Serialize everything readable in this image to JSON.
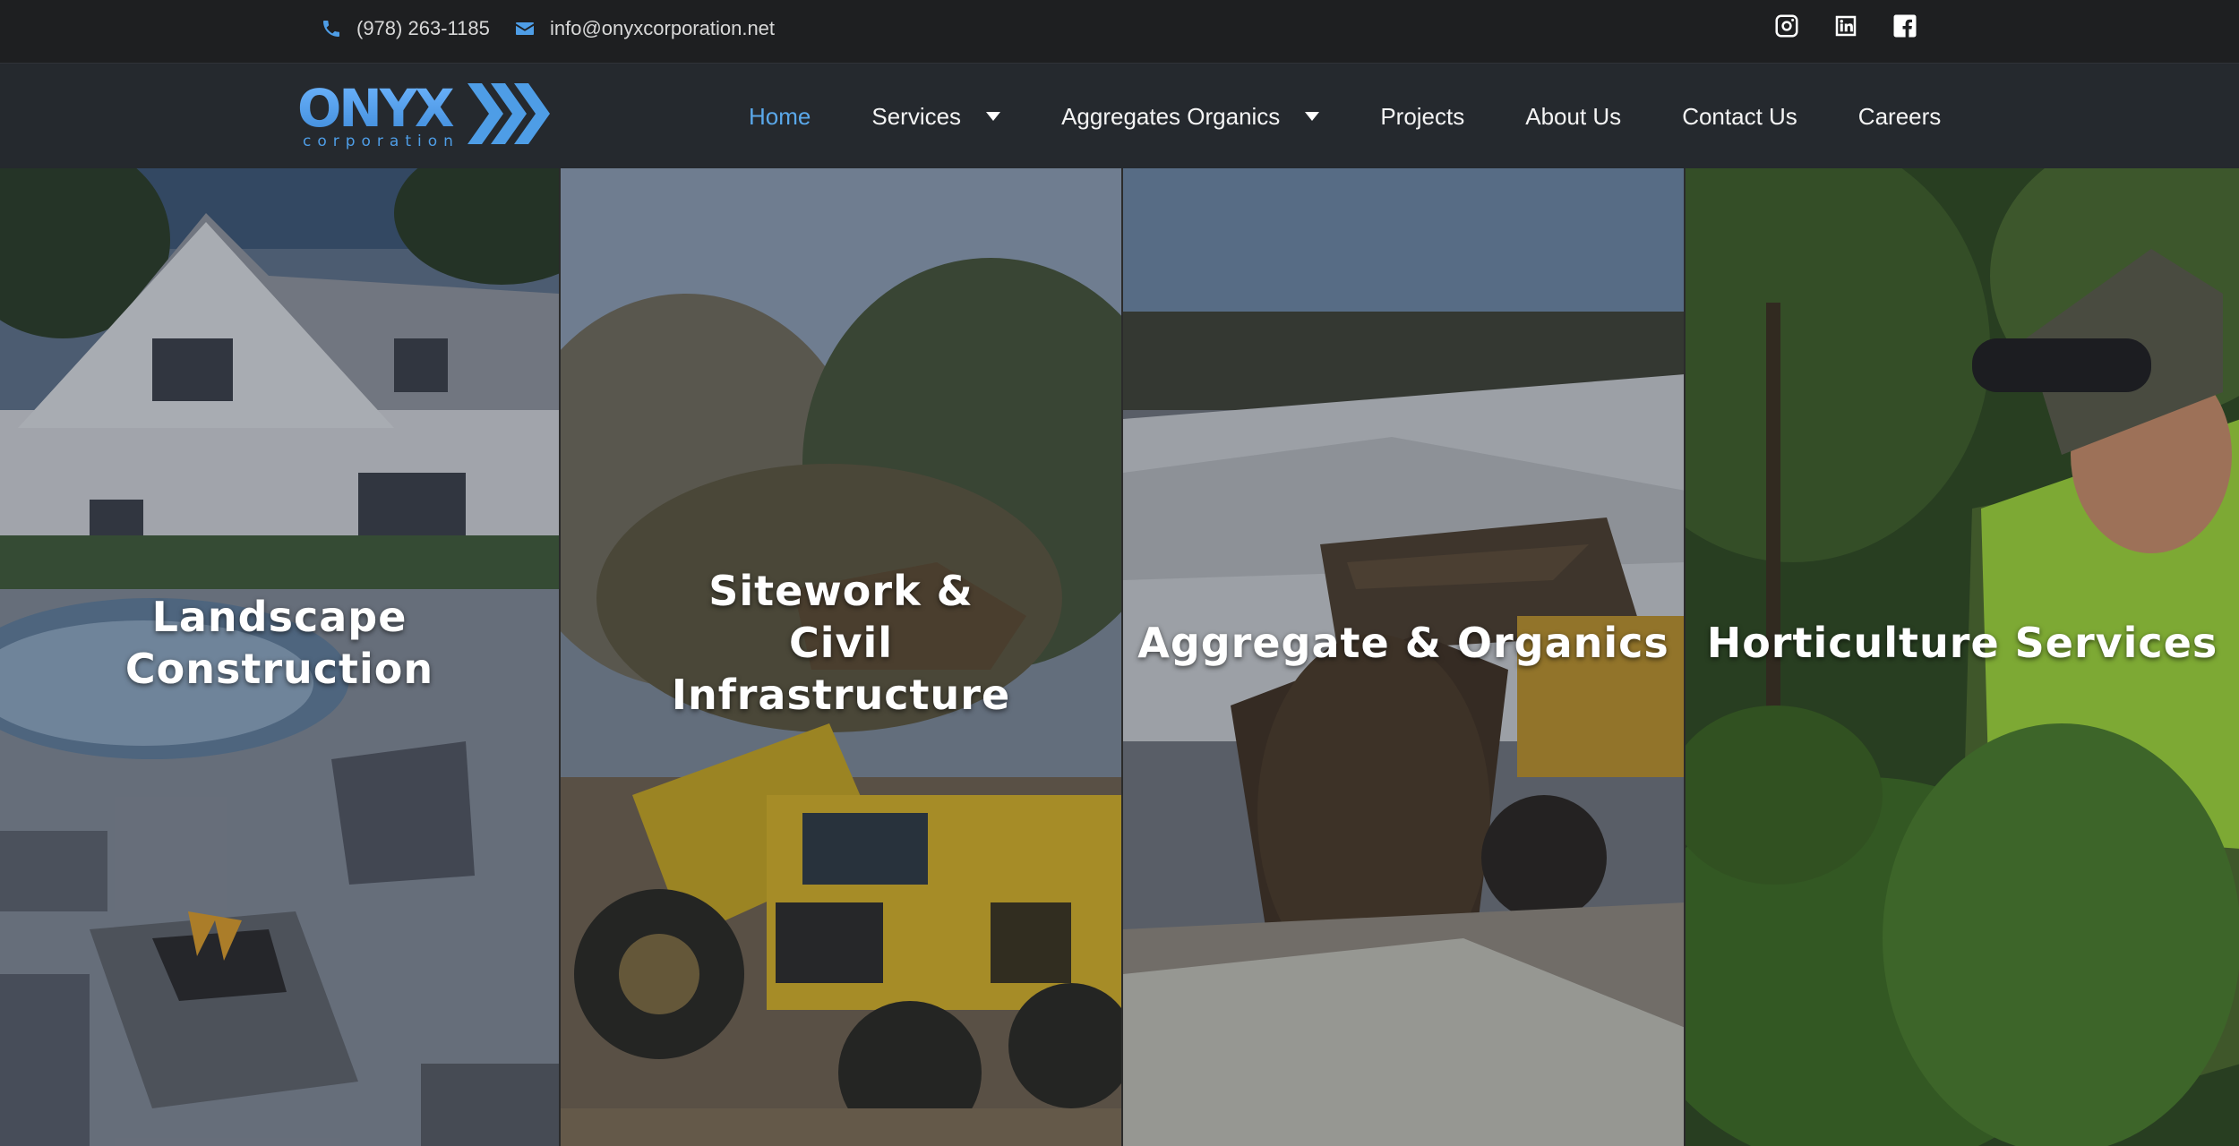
{
  "topbar": {
    "phone": "(978) 263-1185",
    "email": "info@onyxcorporation.net",
    "social": [
      "instagram-icon",
      "linkedin-icon",
      "facebook-icon"
    ]
  },
  "brand": {
    "name": "ONYX",
    "tagline": "corporation",
    "accent": "#4e9de6"
  },
  "nav": {
    "items": [
      {
        "label": "Home",
        "active": true
      },
      {
        "label": "Services",
        "dropdown": true
      },
      {
        "label": "Aggregates Organics",
        "dropdown": true
      },
      {
        "label": "Projects"
      },
      {
        "label": "About Us"
      },
      {
        "label": "Contact Us"
      },
      {
        "label": "Careers"
      }
    ]
  },
  "panels": [
    {
      "title": "Landscape Construction"
    },
    {
      "title": "Sitework & Civil Infrastructure"
    },
    {
      "title": "Aggregate & Organics"
    },
    {
      "title": "Horticulture Services"
    }
  ]
}
